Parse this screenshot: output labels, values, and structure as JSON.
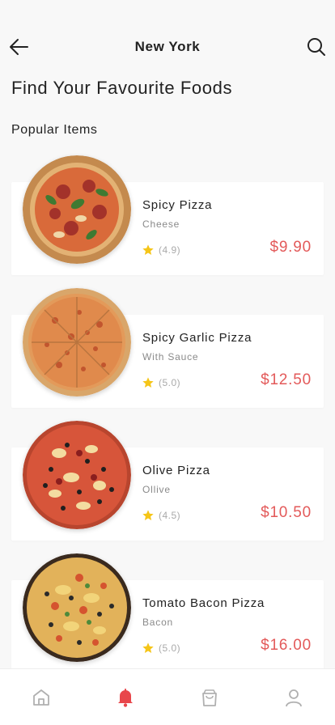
{
  "header": {
    "title": "New York",
    "back_icon": "arrow-left-icon",
    "search_icon": "search-icon"
  },
  "page": {
    "heading": "Find Your Favourite Foods",
    "section_title": "Popular Items"
  },
  "items": [
    {
      "name": "Spicy Pizza",
      "subtitle": "Cheese",
      "rating": "(4.9)",
      "price": "$9.90"
    },
    {
      "name": "Spicy Garlic Pizza",
      "subtitle": "With Sauce",
      "rating": "(5.0)",
      "price": "$12.50"
    },
    {
      "name": "Olive Pizza",
      "subtitle": "Ollive",
      "rating": "(4.5)",
      "price": "$10.50"
    },
    {
      "name": "Tomato Bacon Pizza",
      "subtitle": "Bacon",
      "rating": "(5.0)",
      "price": "$16.00"
    }
  ],
  "bottom_nav": [
    {
      "icon": "home-icon",
      "active": false
    },
    {
      "icon": "bell-icon",
      "active": true
    },
    {
      "icon": "shopping-bag-icon",
      "active": false
    },
    {
      "icon": "user-icon",
      "active": false
    }
  ],
  "colors": {
    "price": "#e35a5a",
    "star": "#f5c518",
    "active_nav": "#e8464b",
    "inactive_nav": "#b0b0b0"
  }
}
